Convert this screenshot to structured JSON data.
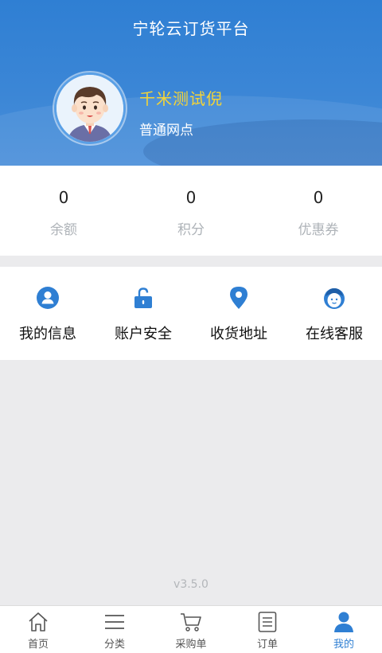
{
  "header": {
    "title": "宁轮云订货平台",
    "user_name": "千米测试倪",
    "user_type": "普通网点"
  },
  "stats": [
    {
      "value": "0",
      "label": "余额"
    },
    {
      "value": "0",
      "label": "积分"
    },
    {
      "value": "0",
      "label": "优惠券"
    }
  ],
  "menu": [
    {
      "label": "我的信息",
      "icon": "user-circle-icon"
    },
    {
      "label": "账户安全",
      "icon": "unlock-icon"
    },
    {
      "label": "收货地址",
      "icon": "location-pin-icon"
    },
    {
      "label": "在线客服",
      "icon": "customer-service-icon"
    }
  ],
  "version": "v3.5.0",
  "tabbar": [
    {
      "label": "首页",
      "icon": "home-icon"
    },
    {
      "label": "分类",
      "icon": "list-icon"
    },
    {
      "label": "采购单",
      "icon": "cart-icon"
    },
    {
      "label": "订单",
      "icon": "order-document-icon"
    },
    {
      "label": "我的",
      "icon": "person-icon",
      "active": true
    }
  ],
  "colors": {
    "primary": "#2f7fd3",
    "username": "#f4d437",
    "background": "#ebebed"
  }
}
